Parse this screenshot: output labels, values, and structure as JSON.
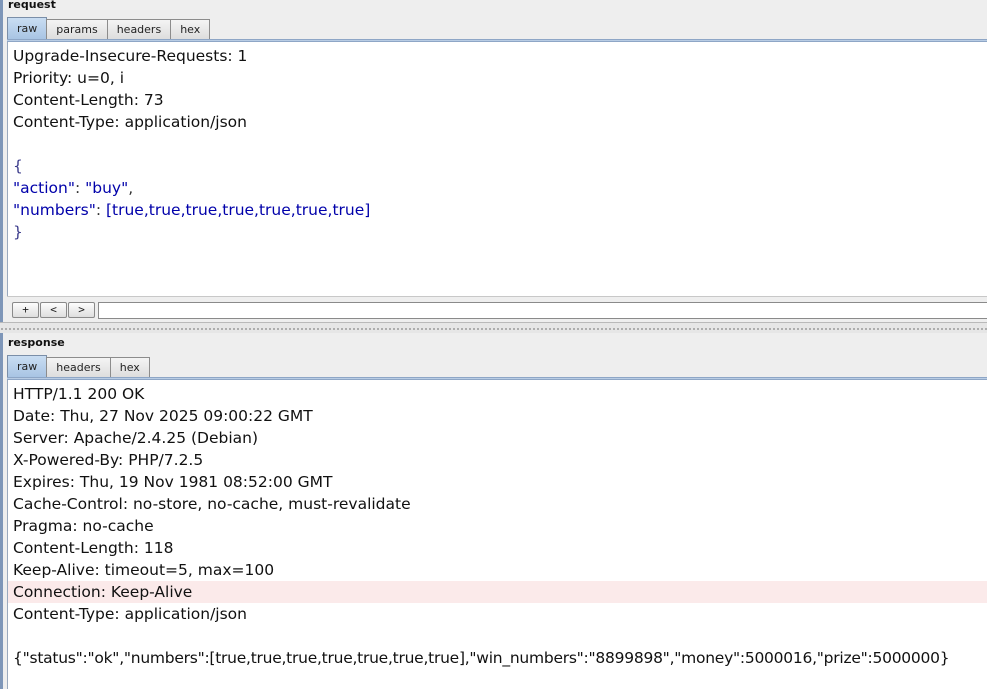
{
  "request": {
    "title": "request",
    "tabs": [
      "raw",
      "params",
      "headers",
      "hex"
    ],
    "active_tab": "raw",
    "headers": [
      "Upgrade-Insecure-Requests: 1",
      "Priority: u=0, i",
      "Content-Length: 73",
      "Content-Type: application/json"
    ],
    "body": {
      "open": "{",
      "action_key": "\"action\"",
      "action_value": "\"buy\"",
      "numbers_key": "\"numbers\"",
      "numbers_value": "[true,true,true,true,true,true,true]",
      "close": "}"
    },
    "toolbar": {
      "add_label": "+",
      "prev_label": "<",
      "next_label": ">",
      "search_value": ""
    }
  },
  "response": {
    "title": "response",
    "tabs": [
      "raw",
      "headers",
      "hex"
    ],
    "active_tab": "raw",
    "lines": [
      "HTTP/1.1 200 OK",
      "Date: Thu, 27 Nov 2025 09:00:22 GMT",
      "Server: Apache/2.4.25 (Debian)",
      "X-Powered-By: PHP/7.2.5",
      "Expires: Thu, 19 Nov 1981 08:52:00 GMT",
      "Cache-Control: no-store, no-cache, must-revalidate",
      "Pragma: no-cache",
      "Content-Length: 118",
      "Keep-Alive: timeout=5, max=100",
      "Connection: Keep-Alive",
      "Content-Type: application/json"
    ],
    "highlighted_line": "Connection: Keep-Alive",
    "body": "{\"status\":\"ok\",\"numbers\":[true,true,true,true,true,true,true],\"win_numbers\":\"8899898\",\"money\":5000016,\"prize\":5000000}"
  },
  "colors": {
    "accent_border": "#7e96b8",
    "active_tab": "#b8cce4",
    "highlight_row": "#fbeaea",
    "json_key": "#0000aa"
  }
}
